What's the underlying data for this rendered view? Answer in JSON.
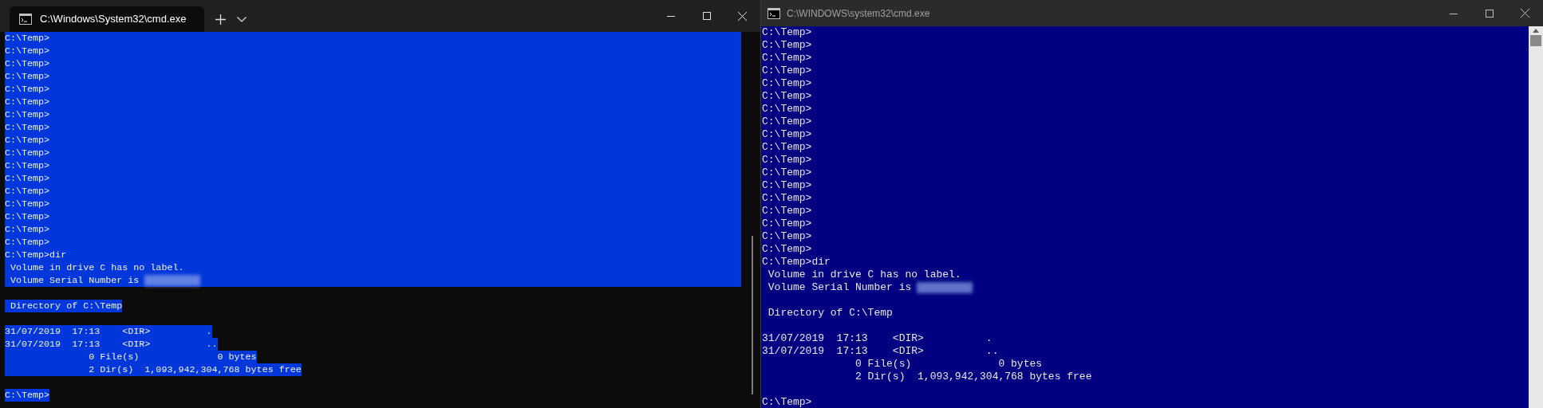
{
  "left_window": {
    "tab_title": "C:\\Windows\\System32\\cmd.exe",
    "lines": [
      {
        "kind": "block",
        "text": "C:\\Temp>",
        "selected": true
      },
      {
        "kind": "block",
        "text": "C:\\Temp>",
        "selected": true
      },
      {
        "kind": "block",
        "text": "C:\\Temp>",
        "selected": true
      },
      {
        "kind": "block",
        "text": "C:\\Temp>",
        "selected": true
      },
      {
        "kind": "block",
        "text": "C:\\Temp>",
        "selected": true
      },
      {
        "kind": "block",
        "text": "C:\\Temp>",
        "selected": true
      },
      {
        "kind": "block",
        "text": "C:\\Temp>",
        "selected": true
      },
      {
        "kind": "block",
        "text": "C:\\Temp>",
        "selected": true
      },
      {
        "kind": "block",
        "text": "C:\\Temp>",
        "selected": true
      },
      {
        "kind": "block",
        "text": "C:\\Temp>",
        "selected": true
      },
      {
        "kind": "block",
        "text": "C:\\Temp>",
        "selected": true
      },
      {
        "kind": "block",
        "text": "C:\\Temp>",
        "selected": true
      },
      {
        "kind": "block",
        "text": "C:\\Temp>",
        "selected": true
      },
      {
        "kind": "block",
        "text": "C:\\Temp>",
        "selected": true
      },
      {
        "kind": "block",
        "text": "C:\\Temp>",
        "selected": true
      },
      {
        "kind": "block",
        "text": "C:\\Temp>",
        "selected": true
      },
      {
        "kind": "block",
        "text": "C:\\Temp>",
        "selected": true
      },
      {
        "kind": "block",
        "text": "C:\\Temp>dir",
        "selected": true
      },
      {
        "kind": "block",
        "text": " Volume in drive C has no label.",
        "selected": true
      },
      {
        "kind": "block",
        "text": " Volume Serial Number is",
        "selected": true,
        "redacted": true
      },
      {
        "kind": "blank"
      },
      {
        "kind": "line",
        "text": " Directory of C:\\Temp",
        "selected": true
      },
      {
        "kind": "blank"
      },
      {
        "kind": "line",
        "text": "31/07/2019  17:13    <DIR>          .",
        "selected": true
      },
      {
        "kind": "line",
        "text": "31/07/2019  17:13    <DIR>          ..",
        "selected": true
      },
      {
        "kind": "line",
        "text": "               0 File(s)              0 bytes",
        "selected": true
      },
      {
        "kind": "line",
        "text": "               2 Dir(s)  1,093,942,304,768 bytes free",
        "selected": true
      },
      {
        "kind": "blank"
      },
      {
        "kind": "line",
        "text": "C:\\Temp>",
        "selected": true
      }
    ]
  },
  "right_window": {
    "title": "C:\\WINDOWS\\system32\\cmd.exe",
    "lines": [
      {
        "kind": "line",
        "text": "C:\\Temp>"
      },
      {
        "kind": "line",
        "text": "C:\\Temp>"
      },
      {
        "kind": "line",
        "text": "C:\\Temp>"
      },
      {
        "kind": "line",
        "text": "C:\\Temp>"
      },
      {
        "kind": "line",
        "text": "C:\\Temp>"
      },
      {
        "kind": "line",
        "text": "C:\\Temp>"
      },
      {
        "kind": "line",
        "text": "C:\\Temp>"
      },
      {
        "kind": "line",
        "text": "C:\\Temp>"
      },
      {
        "kind": "line",
        "text": "C:\\Temp>"
      },
      {
        "kind": "line",
        "text": "C:\\Temp>"
      },
      {
        "kind": "line",
        "text": "C:\\Temp>"
      },
      {
        "kind": "line",
        "text": "C:\\Temp>"
      },
      {
        "kind": "line",
        "text": "C:\\Temp>"
      },
      {
        "kind": "line",
        "text": "C:\\Temp>"
      },
      {
        "kind": "line",
        "text": "C:\\Temp>"
      },
      {
        "kind": "line",
        "text": "C:\\Temp>"
      },
      {
        "kind": "line",
        "text": "C:\\Temp>"
      },
      {
        "kind": "line",
        "text": "C:\\Temp>"
      },
      {
        "kind": "line",
        "text": "C:\\Temp>dir"
      },
      {
        "kind": "line",
        "text": " Volume in drive C has no label."
      },
      {
        "kind": "line",
        "text": " Volume Serial Number is",
        "redacted": true
      },
      {
        "kind": "blank"
      },
      {
        "kind": "line",
        "text": " Directory of C:\\Temp"
      },
      {
        "kind": "blank"
      },
      {
        "kind": "line",
        "text": "31/07/2019  17:13    <DIR>          ."
      },
      {
        "kind": "line",
        "text": "31/07/2019  17:13    <DIR>          .."
      },
      {
        "kind": "line",
        "text": "               0 File(s)              0 bytes"
      },
      {
        "kind": "line",
        "text": "               2 Dir(s)  1,093,942,304,768 bytes free"
      },
      {
        "kind": "blank"
      },
      {
        "kind": "line",
        "text": "C:\\Temp>"
      }
    ]
  }
}
